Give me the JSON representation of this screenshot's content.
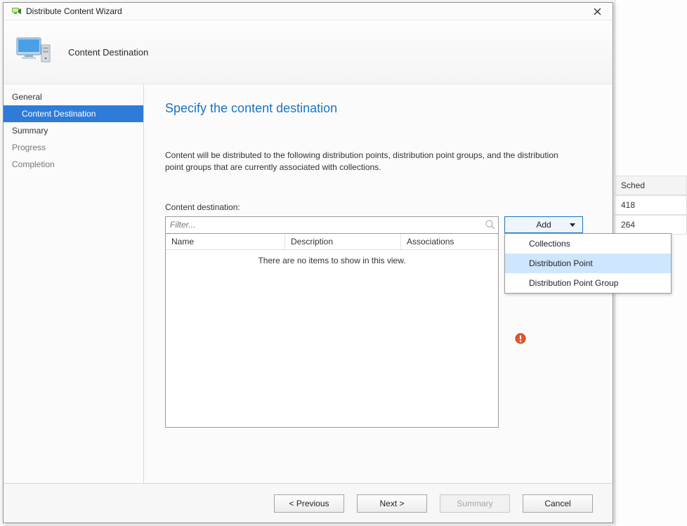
{
  "window": {
    "title": "Distribute Content Wizard"
  },
  "header": {
    "title": "Content Destination"
  },
  "nav": {
    "items": [
      {
        "label": "General",
        "state": "normal"
      },
      {
        "label": "Content Destination",
        "state": "active"
      },
      {
        "label": "Summary",
        "state": "normal"
      },
      {
        "label": "Progress",
        "state": "dim"
      },
      {
        "label": "Completion",
        "state": "dim"
      }
    ]
  },
  "page": {
    "title": "Specify the content destination",
    "description": "Content will be distributed to the following distribution points, distribution point groups, and the distribution point groups that are currently associated with collections.",
    "field_label": "Content destination:",
    "filter_placeholder": "Filter...",
    "columns": {
      "name": "Name",
      "description": "Description",
      "associations": "Associations"
    },
    "empty_text": "There are no items to show in this view."
  },
  "add": {
    "label": "Add",
    "menu": [
      {
        "label": "Collections",
        "hover": false
      },
      {
        "label": "Distribution Point",
        "hover": true
      },
      {
        "label": "Distribution Point Group",
        "hover": false
      }
    ]
  },
  "footer": {
    "previous": "< Previous",
    "next": "Next >",
    "summary": "Summary",
    "cancel": "Cancel"
  },
  "background": {
    "header_label": "Sched",
    "rows": [
      "418",
      "264"
    ]
  }
}
